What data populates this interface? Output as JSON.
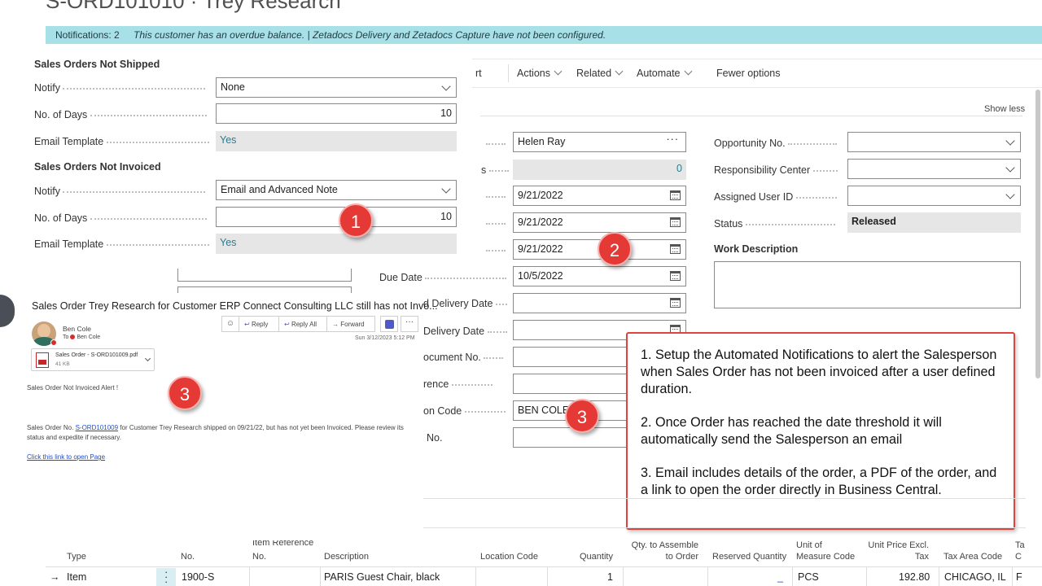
{
  "page": {
    "title": "S-ORD101010 · Trey Research"
  },
  "notifications": {
    "count_label": "Notifications: 2",
    "message": "This customer has an overdue balance. | Zetadocs Delivery and Zetadocs Capture have not been configured."
  },
  "actions": {
    "partial": "rt",
    "items": [
      "Actions",
      "Related",
      "Automate"
    ],
    "fewer": "Fewer options",
    "show_less": "Show less"
  },
  "not_shipped": {
    "heading": "Sales Orders Not Shipped",
    "notify_label": "Notify",
    "notify_value": "None",
    "days_label": "No. of Days",
    "days_value": "10",
    "template_label": "Email Template",
    "template_value": "Yes"
  },
  "not_invoiced": {
    "heading": "Sales Orders Not Invoiced",
    "notify_label": "Notify",
    "notify_value": "Email and Advanced Note",
    "days_label": "No. of Days",
    "days_value": "10",
    "template_label": "Email Template",
    "template_value": "Yes"
  },
  "middle_fields": {
    "contact_value": "Helen Ray",
    "partial_s_label": "s",
    "count_value": "0",
    "date1": "9/21/2022",
    "date2": "9/21/2022",
    "date3": "9/21/2022",
    "due_date_label": "Due Date",
    "due_date_value": "10/5/2022",
    "req_delivery_label": "d Delivery Date",
    "prom_delivery_label": "Delivery Date",
    "ext_doc_label": "ocument No.",
    "reference_label": "rence",
    "salesperson_label": "on Code",
    "salesperson_value": "BEN COLE",
    "no_label": "No."
  },
  "right_fields": {
    "opportunity_label": "Opportunity No.",
    "responsibility_label": "Responsibility Center",
    "assigned_label": "Assigned User ID",
    "status_label": "Status",
    "status_value": "Released",
    "work_desc_label": "Work Description"
  },
  "email": {
    "subject": "Sales Order Trey Research for Customer ERP Connect Consulting LLC still has not Invo...",
    "sender": "Ben Cole",
    "to_label": "To",
    "to_name": "Ben Cole",
    "date": "Sun 3/12/2023 5:12 PM",
    "reply": "Reply",
    "reply_all": "Reply All",
    "forward": "Forward",
    "attachment_name": "Sales Order - S-ORD101009.pdf",
    "attachment_size": "41 KB",
    "alert_title": "Sales Order Not Invoiced Alert !",
    "body_prefix": "Sales Order No. ",
    "body_order_link": "S-ORD101009",
    "body_rest": " for Customer Trey Research shipped on 09/21/22, but has not yet been Invoiced.  Please review its status and expedite if necessary.",
    "open_link": "Click this link to open Page"
  },
  "markers": {
    "one": "1",
    "two": "2",
    "three": "3"
  },
  "callout": {
    "p1": "1. Setup the Automated Notifications to alert the Salesperson when Sales Order has not been invoiced after a user defined duration.",
    "p2": "2. Once Order has reached the date threshold it will automatically send the Salesperson an email",
    "p3": "3. Email includes details of the order, a PDF of the order, and a link to open the order directly in Business Central."
  },
  "lines": {
    "headers": {
      "type": "Type",
      "no": "No.",
      "item_ref": "Item Reference",
      "item_ref_no": "No.",
      "description": "Description",
      "location": "Location Code",
      "quantity": "Quantity",
      "qty_assemble_1": "Qty. to Assemble",
      "qty_assemble_2": "to Order",
      "reserved": "Reserved Quantity",
      "uom_1": "Unit of",
      "uom_2": "Measure Code",
      "price_1": "Unit Price Excl.",
      "price_2": "Tax",
      "tax_area": "Tax Area Code",
      "last_1": "Ta",
      "last_2": "C"
    },
    "row": {
      "arrow": "→",
      "type": "Item",
      "no": "1900-S",
      "description": "PARIS Guest Chair, black",
      "quantity": "1",
      "reserved": "_",
      "uom": "PCS",
      "price": "192.80",
      "tax_area": "CHICAGO, IL",
      "last": "F"
    }
  },
  "colors": {
    "notif_bg": "#a8e0e8",
    "marker": "#e53935",
    "callout_border": "#e0433e",
    "readonly_bg": "#e6e6e6"
  }
}
